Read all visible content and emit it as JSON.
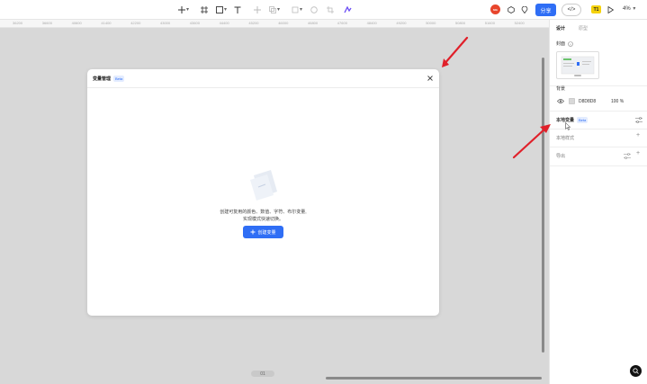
{
  "toolbar": {
    "share_label": "分享",
    "code_label": "</>",
    "ai_label": "T1",
    "zoom_label": "4%",
    "avatar_label": "MG"
  },
  "ruler": {
    "ticks": [
      "36200",
      "36600",
      "40600",
      "41400",
      "42200",
      "43000",
      "43600",
      "44400",
      "45200",
      "46000",
      "46800",
      "47600",
      "48400",
      "49200",
      "50000",
      "50800",
      "51600",
      "52400"
    ]
  },
  "modal": {
    "title": "变量管理",
    "beta": "Beta",
    "empty_line1": "创建可复用的颜色、数值、字符、布尔变量,",
    "empty_line2": "实现模式快速切换。",
    "create_label": "创建变量",
    "create_icon": "plus-icon"
  },
  "panel": {
    "tab_design": "设计",
    "tab_prototype": "原型",
    "cover_label": "封面",
    "background_label": "背景",
    "bg_hex": "D8D8D8",
    "bg_percent": "100",
    "bg_percent_unit": "%",
    "local_vars_label": "本地变量",
    "local_vars_beta": "Beta",
    "local_styles_label": "本地样式",
    "export_label": "导出"
  },
  "canvas": {
    "page_indicator": "01"
  },
  "colors": {
    "accent": "#2f6ef5",
    "canvas": "#d8d8d8",
    "annotation_arrow": "#e0202a",
    "ai_badge": "#f5d20b",
    "avatar": "#e8452c"
  }
}
